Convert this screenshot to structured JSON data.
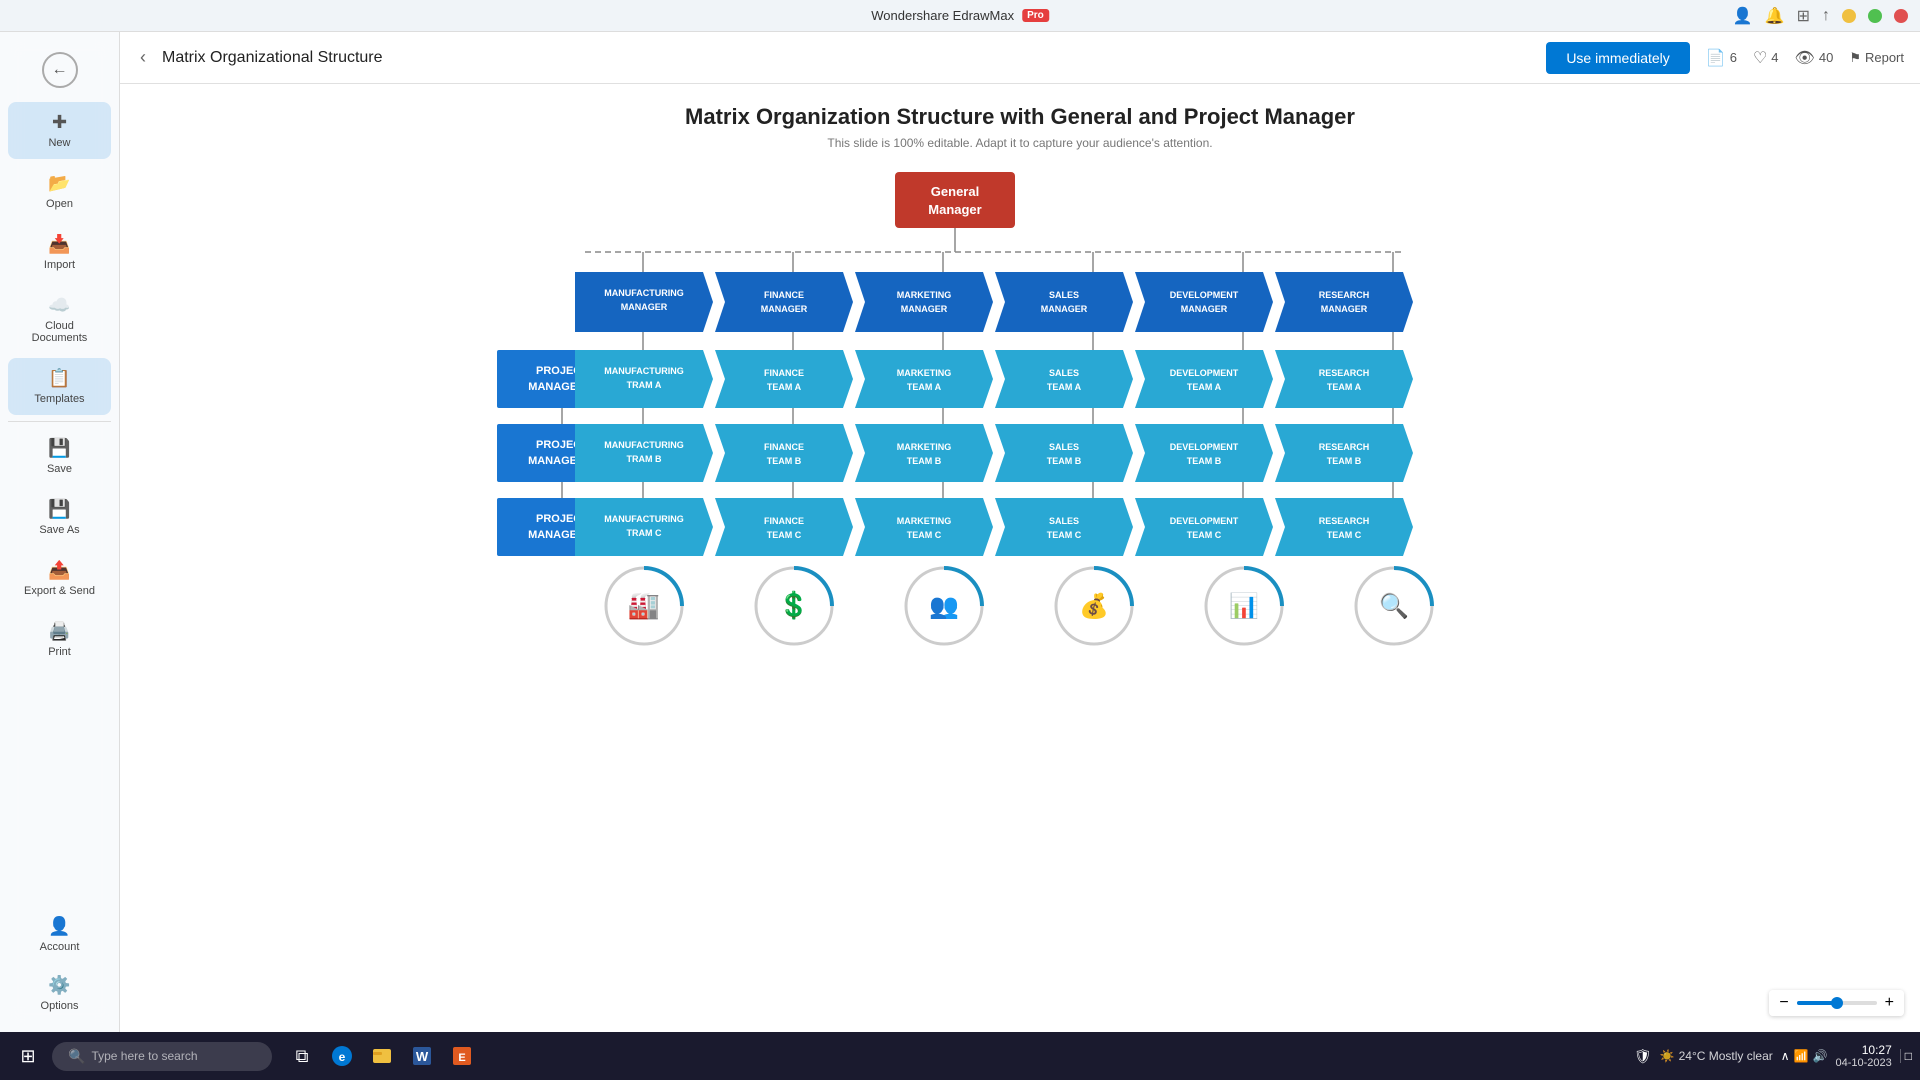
{
  "app": {
    "title": "Wondershare EdrawMax",
    "badge": "Pro",
    "window_controls": [
      "minimize",
      "restore",
      "close"
    ]
  },
  "titlebar": {
    "right_icons": [
      "settings-icon",
      "bell-icon",
      "grid-icon",
      "download-icon"
    ]
  },
  "sidebar": {
    "back_label": "←",
    "items": [
      {
        "id": "new",
        "label": "New",
        "icon": "+"
      },
      {
        "id": "open",
        "label": "Open",
        "icon": "📂"
      },
      {
        "id": "import",
        "label": "Import",
        "icon": "📥"
      },
      {
        "id": "cloud",
        "label": "Cloud Documents",
        "icon": "☁️"
      },
      {
        "id": "templates",
        "label": "Templates",
        "icon": "📋"
      },
      {
        "id": "save",
        "label": "Save",
        "icon": "💾"
      },
      {
        "id": "saveas",
        "label": "Save As",
        "icon": "💾"
      },
      {
        "id": "export",
        "label": "Export & Send",
        "icon": "📤"
      },
      {
        "id": "print",
        "label": "Print",
        "icon": "🖨️"
      }
    ],
    "bottom_items": [
      {
        "id": "account",
        "label": "Account",
        "icon": "👤"
      },
      {
        "id": "options",
        "label": "Options",
        "icon": "⚙️"
      }
    ]
  },
  "toolbar": {
    "back_label": "‹",
    "title": "Matrix Organizational Structure",
    "use_immediately": "Use immediately",
    "stats": {
      "copies": "6",
      "likes": "4",
      "views": "40"
    },
    "report_label": "Report"
  },
  "diagram": {
    "title": "Matrix Organization Structure with General and Project Manager",
    "subtitle": "This slide is 100% editable. Adapt it to capture your audience's attention.",
    "gm_label_line1": "General",
    "gm_label_line2": "Manager",
    "managers": [
      {
        "id": "manufacturing",
        "label": "MANUFACTURING MANAGER"
      },
      {
        "id": "finance",
        "label": "FINANCE MANAGER"
      },
      {
        "id": "marketing",
        "label": "MARKETING MANAGER"
      },
      {
        "id": "sales",
        "label": "SALES MANAGER"
      },
      {
        "id": "development",
        "label": "DEVELOPMENT MANAGER"
      },
      {
        "id": "research",
        "label": "RESEARCH MANAGER"
      }
    ],
    "rows": [
      {
        "pm": "PROJECT MANAGER A",
        "teams": [
          "MANUFACTURING TRAM A",
          "FINANCE TEAM A",
          "MARKETING TEAM A",
          "SALES TEAM A",
          "DEVELOPMENT TEAM A",
          "RESEARCH TEAM A"
        ]
      },
      {
        "pm": "PROJECT MANAGER B",
        "teams": [
          "MANUFACTURING TRAM B",
          "FINANCE TEAM B",
          "MARKETING TEAM B",
          "SALES TEAM B",
          "DEVELOPMENT TEAM B",
          "RESEARCH TEAM B"
        ]
      },
      {
        "pm": "PROJECT MANAGER C",
        "teams": [
          "MANUFACTURING TRAM C",
          "FINANCE TEAM C",
          "MARKETING TEAM C",
          "SALES TEAM C",
          "DEVELOPMENT TEAM C",
          "RESEARCH TEAM C"
        ]
      }
    ],
    "icons": [
      "🏭",
      "💲",
      "👥",
      "💰",
      "📊",
      "🔍"
    ]
  },
  "taskbar": {
    "search_placeholder": "Type here to search",
    "apps": [
      "windows-icon",
      "search-icon",
      "taskview-icon",
      "edge-icon",
      "explorer-icon",
      "word-icon",
      "edraw-icon"
    ],
    "weather": "24°C  Mostly clear",
    "time": "10:27",
    "date": "04-10-2023"
  },
  "colors": {
    "gm_bg": "#c0392b",
    "manager_bg": "#1565c0",
    "pm_bg": "#1976d2",
    "team_bg": "#29a8d4",
    "accent": "#0078d4"
  }
}
